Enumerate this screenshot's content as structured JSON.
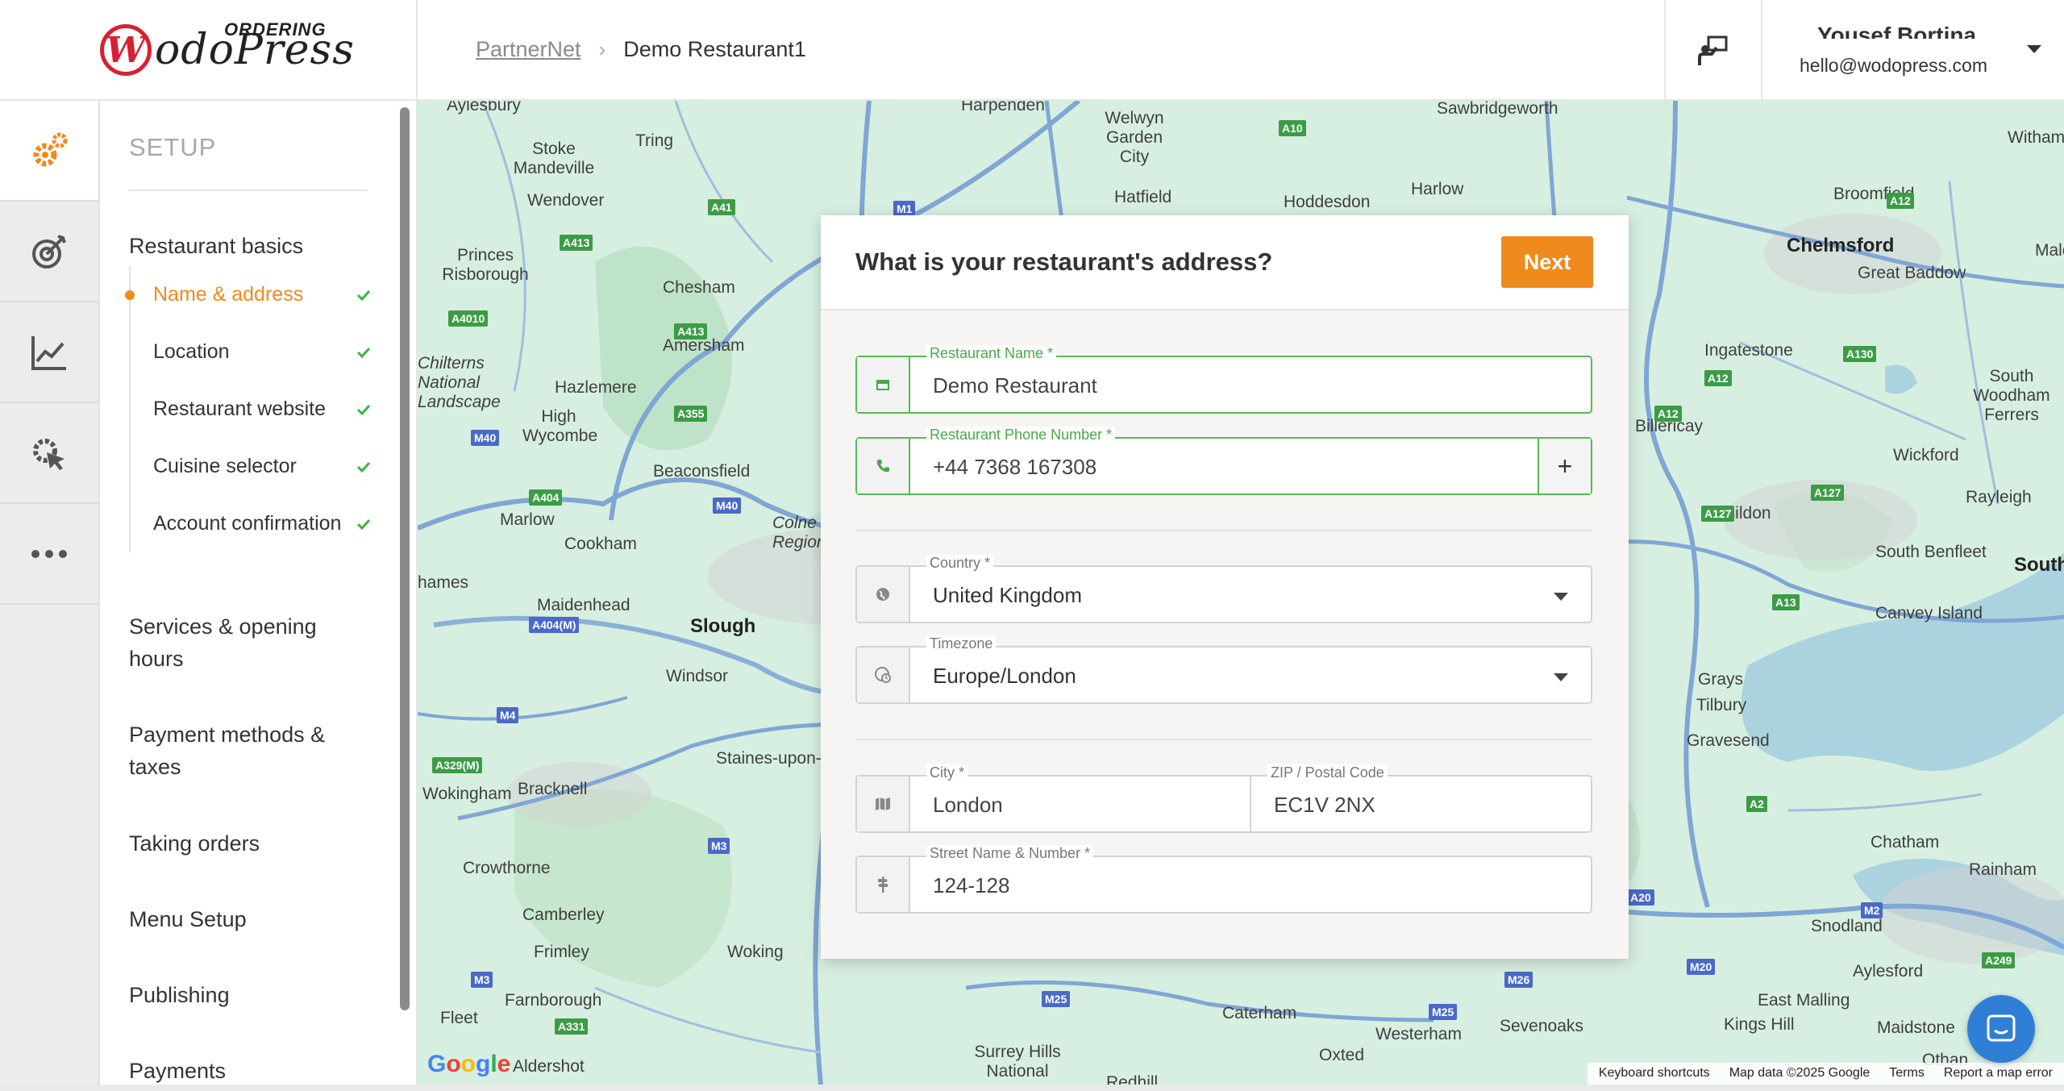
{
  "brand": {
    "ordering": "ORDERING",
    "name": "odoPress",
    "mark": "W"
  },
  "breadcrumb": {
    "parent": "PartnerNet",
    "current": "Demo Restaurant1"
  },
  "user": {
    "name": "Yousef Bortina",
    "email": "hello@wodopress.com"
  },
  "sidebar": {
    "title": "SETUP",
    "restaurant_basics": "Restaurant basics",
    "sub_items": [
      {
        "label": "Name & address"
      },
      {
        "label": "Location"
      },
      {
        "label": "Restaurant website"
      },
      {
        "label": "Cuisine selector"
      },
      {
        "label": "Account confirmation"
      }
    ],
    "sections": [
      "Services & opening hours",
      "Payment methods & taxes",
      "Taking orders",
      "Menu Setup",
      "Publishing",
      "Payments"
    ]
  },
  "modal": {
    "title": "What is your restaurant's address?",
    "next_label": "Next",
    "fields": {
      "name": {
        "label": "Restaurant Name *",
        "value": "Demo Restaurant"
      },
      "phone": {
        "label": "Restaurant Phone Number *",
        "value": "+44 7368 167308",
        "add": "+"
      },
      "country": {
        "label": "Country *",
        "value": "United Kingdom"
      },
      "timezone": {
        "label": "Timezone",
        "value": "Europe/London"
      },
      "city": {
        "label": "City *",
        "value": "London"
      },
      "zip": {
        "label": "ZIP / Postal Code",
        "value": "EC1V 2NX"
      },
      "street": {
        "label": "Street Name & Number *",
        "value": "124-128"
      }
    }
  },
  "map": {
    "places": [
      "Aylesbury",
      "Harpenden",
      "Welwyn Garden City",
      "Sawbridgeworth",
      "Witham",
      "Stoke Mandeville",
      "Tring",
      "Hatfield",
      "Hoddesdon",
      "Harlow",
      "Broomfield",
      "Wendover",
      "Chelmsford",
      "Great Baddow",
      "Princes Risborough",
      "Chesham",
      "Ingatestone",
      "South Woodham Ferrers",
      "Amersham",
      "Billericay",
      "Chilterns National Landscape",
      "Hazlemere",
      "Wickford",
      "High Wycombe",
      "Beaconsfield",
      "Rayleigh",
      "Basildon",
      "Marlow",
      "Cookham",
      "Colne Regional",
      "South Benfleet",
      "hames",
      "Maidenhead",
      "Slough",
      "Canvey Island",
      "Windsor",
      "Grays",
      "Tilbury",
      "Staines-upon-",
      "Gravesend",
      "Bracknell",
      "Wokingham",
      "Chatham",
      "Crowthorne",
      "Rainham",
      "Camberley",
      "Woking",
      "Snodland",
      "Frimley",
      "Aylesford",
      "East Malling",
      "Farnborough",
      "Caterham",
      "Kings Hill",
      "Maidstone",
      "Fleet",
      "Westerham",
      "Sevenoaks",
      "Surrey Hills National",
      "Aldershot",
      "Oxted",
      "Othan",
      "Maldo",
      "South",
      "Redhill"
    ],
    "roads": [
      "A10",
      "A12",
      "M1",
      "A41",
      "A413",
      "A4010",
      "A355",
      "M40",
      "A404",
      "A404(M)",
      "M4",
      "A329(M)",
      "M3",
      "A331",
      "M25",
      "M26",
      "A127",
      "A130",
      "A13",
      "A2",
      "M2",
      "M20",
      "A249",
      "A20"
    ],
    "footer": [
      "Keyboard shortcuts",
      "Map data ©2025 Google",
      "Terms",
      "Report a map error"
    ],
    "google": "Google"
  }
}
